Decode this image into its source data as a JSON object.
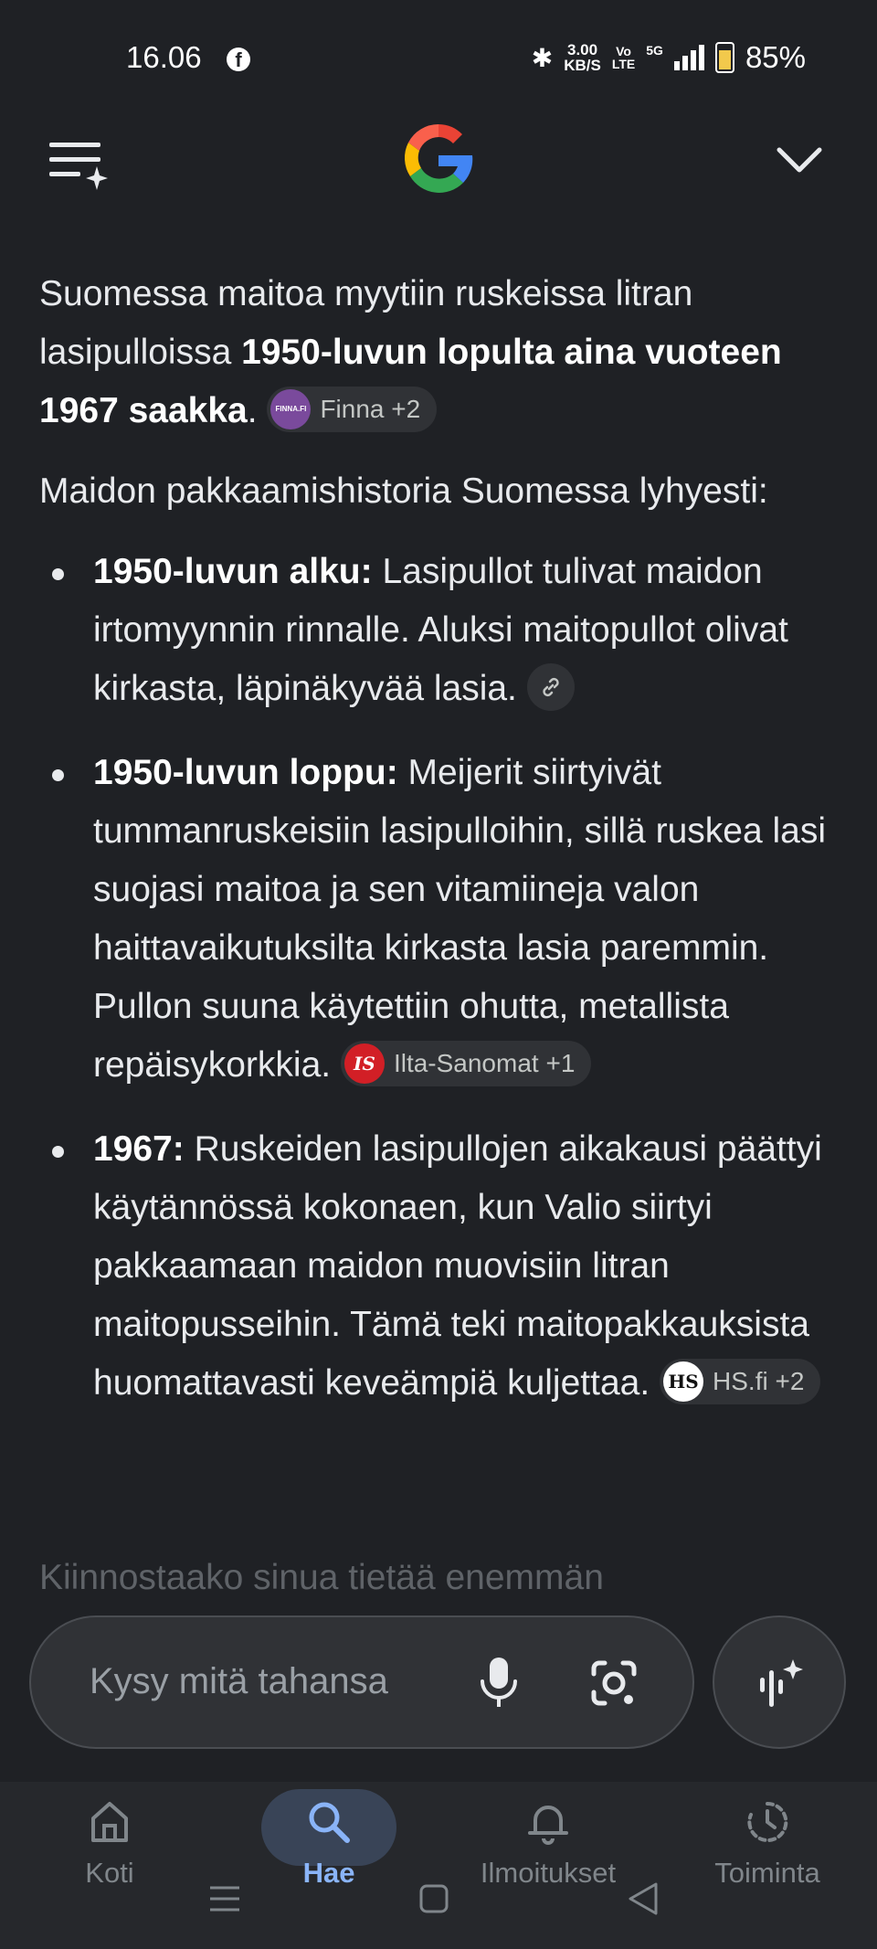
{
  "status_bar": {
    "time": "16.06",
    "facebook_icon": "f",
    "bluetooth_icon": "✱",
    "speed_value": "3.00",
    "speed_unit": "KB/S",
    "volte_top": "Vo",
    "volte_bottom": "LTE",
    "network": "5G",
    "battery": "85%"
  },
  "header": {
    "menu_icon": "menu-sparkle-icon",
    "logo": "google-logo",
    "collapse_icon": "chevron-down-icon"
  },
  "answer": {
    "intro_text_1": "Suomessa maitoa myytiin ruskeissa litran lasipulloissa ",
    "intro_bold": "1950-luvun lopulta aina vuoteen 1967 saakka",
    "intro_text_2": ".",
    "intro_chip": {
      "logo_text": "FINNA.FI",
      "label": "Finna +2"
    },
    "history_heading": "Maidon pakkaamishistoria Suomessa lyhyesti:",
    "points": [
      {
        "bold": "1950-luvun alku:",
        "text": " Lasipullot tulivat maidon irtomyynnin rinnalle. Aluksi maitopullot olivat kirkasta, läpinäkyvää lasia."
      },
      {
        "bold": "1950-luvun loppu:",
        "text": " Meijerit siirtyivät tummanruskeisiin lasipulloihin, sillä ruskea lasi suojasi maitoa ja sen vitamiineja valon haittavaikutuksilta kirkasta lasia paremmin. Pullon suuna käytettiin ohutta, metallista repäisykorkkia.",
        "chip": {
          "logo_text": "IS",
          "label": "Ilta-Sanomat +1"
        }
      },
      {
        "bold": "1967:",
        "text": " Ruskeiden lasipullojen aikakausi päättyi käytännössä kokonaen, kun Valio siirtyi pakkaamaan maidon muovisiin litran maitopusseihin. Tämä teki maitopakkauksista huomattavasti keveämpiä kuljettaa.",
        "chip": {
          "logo_text": "HS",
          "label": "HS.fi +2"
        }
      }
    ],
    "faded_text": "Kiinnostaako sinua tietää enemmän"
  },
  "search": {
    "placeholder": "Kysy mitä tahansa"
  },
  "bottom_nav": {
    "items": [
      {
        "label": "Koti",
        "icon": "home-icon"
      },
      {
        "label": "Hae",
        "icon": "search-icon",
        "active": true
      },
      {
        "label": "Ilmoitukset",
        "icon": "bell-icon"
      },
      {
        "label": "Toiminta",
        "icon": "activity-icon"
      }
    ]
  },
  "colors": {
    "background": "#1f2125",
    "text": "#e8eaed",
    "active": "#8ab4f8",
    "chip_bg": "#303236"
  }
}
